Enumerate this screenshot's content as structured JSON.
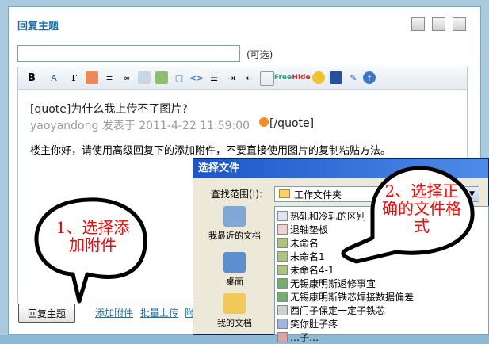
{
  "dialog": {
    "title": "回复主题",
    "optional_label": "(可选)"
  },
  "toolbar": {
    "free_label": "Free",
    "hide_label": "Hide"
  },
  "editor": {
    "quote_line": "[quote]为什么我上传不了图片?",
    "meta_line": "yaoyandong 发表于 2011-4-22 11:59:00",
    "quote_close": "[/quote]",
    "body": "楼主你好，请使用高级回复下的添加附件，不要直接使用图片的复制粘贴方法。"
  },
  "footer": {
    "submit_label": "回复主题",
    "add_attachment": "添加附件",
    "batch_upload": "批量上传",
    "more": "附"
  },
  "file_dialog": {
    "title": "选择文件",
    "look_in_label": "查找范围(I):",
    "look_in_value": "工作文件夹",
    "sidebar": [
      "我最近的文档",
      "桌面",
      "我的文档"
    ],
    "files": [
      "热轧和冷轧的区别",
      "退轴垫板",
      "未命名",
      "未命名1",
      "未命名4-1",
      "无锡康明斯返修事宜",
      "无锡康明斯铁芯焊接数据偏差",
      "西门子保定一定子铁芯",
      "笑你肚子疼",
      "…子…"
    ]
  },
  "callouts": {
    "left": "1、选择添加附件",
    "right": "2、选择正确的文件格式"
  },
  "colors": {
    "accent": "#1f6fa8",
    "callout_text": "#ff0000"
  }
}
